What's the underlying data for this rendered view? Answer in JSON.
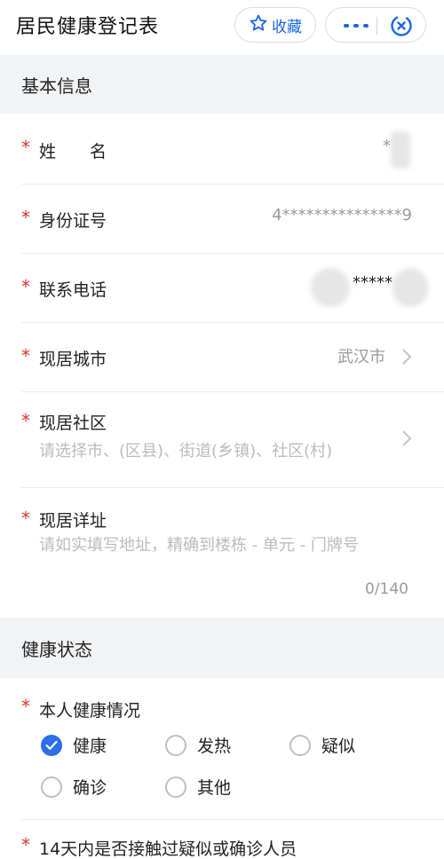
{
  "header": {
    "title": "居民健康登记表",
    "favorite_label": "收藏"
  },
  "sections": {
    "basic": "基本信息",
    "health": "健康状态"
  },
  "fields": {
    "name": {
      "required": "*",
      "label": "姓　　名",
      "value": "*"
    },
    "id_number": {
      "required": "*",
      "label": "身份证号",
      "value": "4***************9"
    },
    "phone": {
      "required": "*",
      "label": "联系电话",
      "value": "*****"
    },
    "city": {
      "required": "*",
      "label": "现居城市",
      "value": "武汉市"
    },
    "community": {
      "required": "*",
      "label": "现居社区",
      "placeholder": "请选择市、(区县)、街道(乡镇)、社区(村)"
    },
    "address": {
      "required": "*",
      "label": "现居详址",
      "placeholder": "请如实填写地址，精确到楼栋 - 单元 - 门牌号",
      "counter": "0/140"
    },
    "health_status": {
      "required": "*",
      "label": "本人健康情况",
      "options": [
        {
          "label": "健康",
          "checked": true
        },
        {
          "label": "发热",
          "checked": false
        },
        {
          "label": "疑似",
          "checked": false
        },
        {
          "label": "确诊",
          "checked": false
        },
        {
          "label": "其他",
          "checked": false
        }
      ]
    },
    "contact": {
      "required": "*",
      "label": "14天内是否接触过疑似或确诊人员"
    }
  },
  "colors": {
    "accent": "#1a66e6",
    "required": "#e0312b",
    "section_bg": "#f2f3f5"
  }
}
